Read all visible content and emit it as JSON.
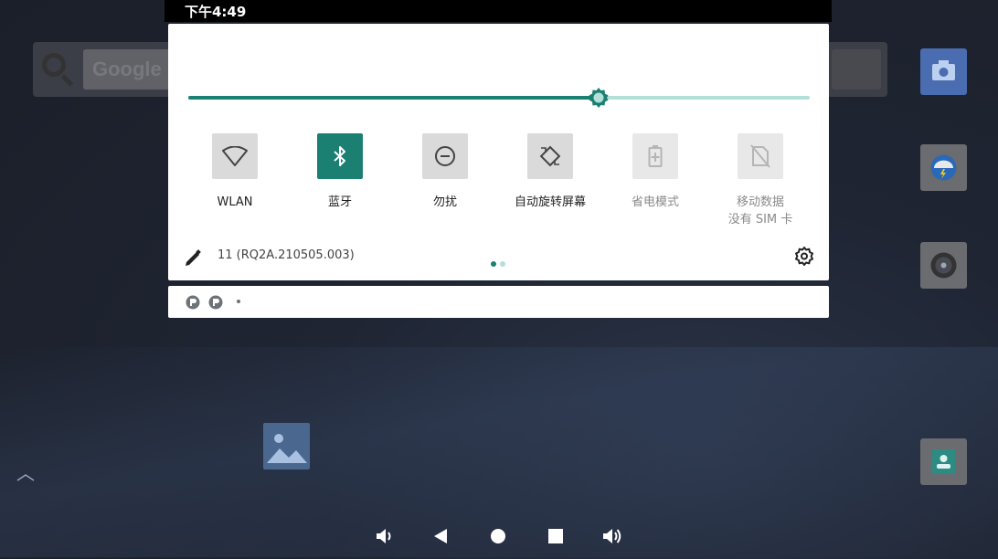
{
  "status_bar": {
    "time": "下午4:49"
  },
  "desktop": {
    "search_hint": "Google"
  },
  "quick_settings": {
    "brightness_level": 0.66,
    "tiles": [
      {
        "label": "WLAN",
        "icon": "wifi-icon",
        "state": "off"
      },
      {
        "label": "蓝牙",
        "icon": "bluetooth-icon",
        "state": "on"
      },
      {
        "label": "勿扰",
        "icon": "do-not-disturb-icon",
        "state": "off"
      },
      {
        "label": "自动旋转屏幕",
        "icon": "auto-rotate-icon",
        "state": "off"
      },
      {
        "label": "省电模式",
        "icon": "battery-saver-icon",
        "state": "disabled"
      },
      {
        "label": "移动数据",
        "sublabel": "没有 SIM 卡",
        "icon": "no-sim-icon",
        "state": "disabled"
      }
    ],
    "build_number": "11 (RQ2A.210505.003)",
    "pages": 2,
    "current_page": 1
  },
  "colors": {
    "accent": "#1b7f72",
    "accent_light": "#b2dfd7"
  },
  "nav": [
    "volume-down-icon",
    "back-icon",
    "home-icon",
    "recents-icon",
    "volume-up-icon"
  ]
}
